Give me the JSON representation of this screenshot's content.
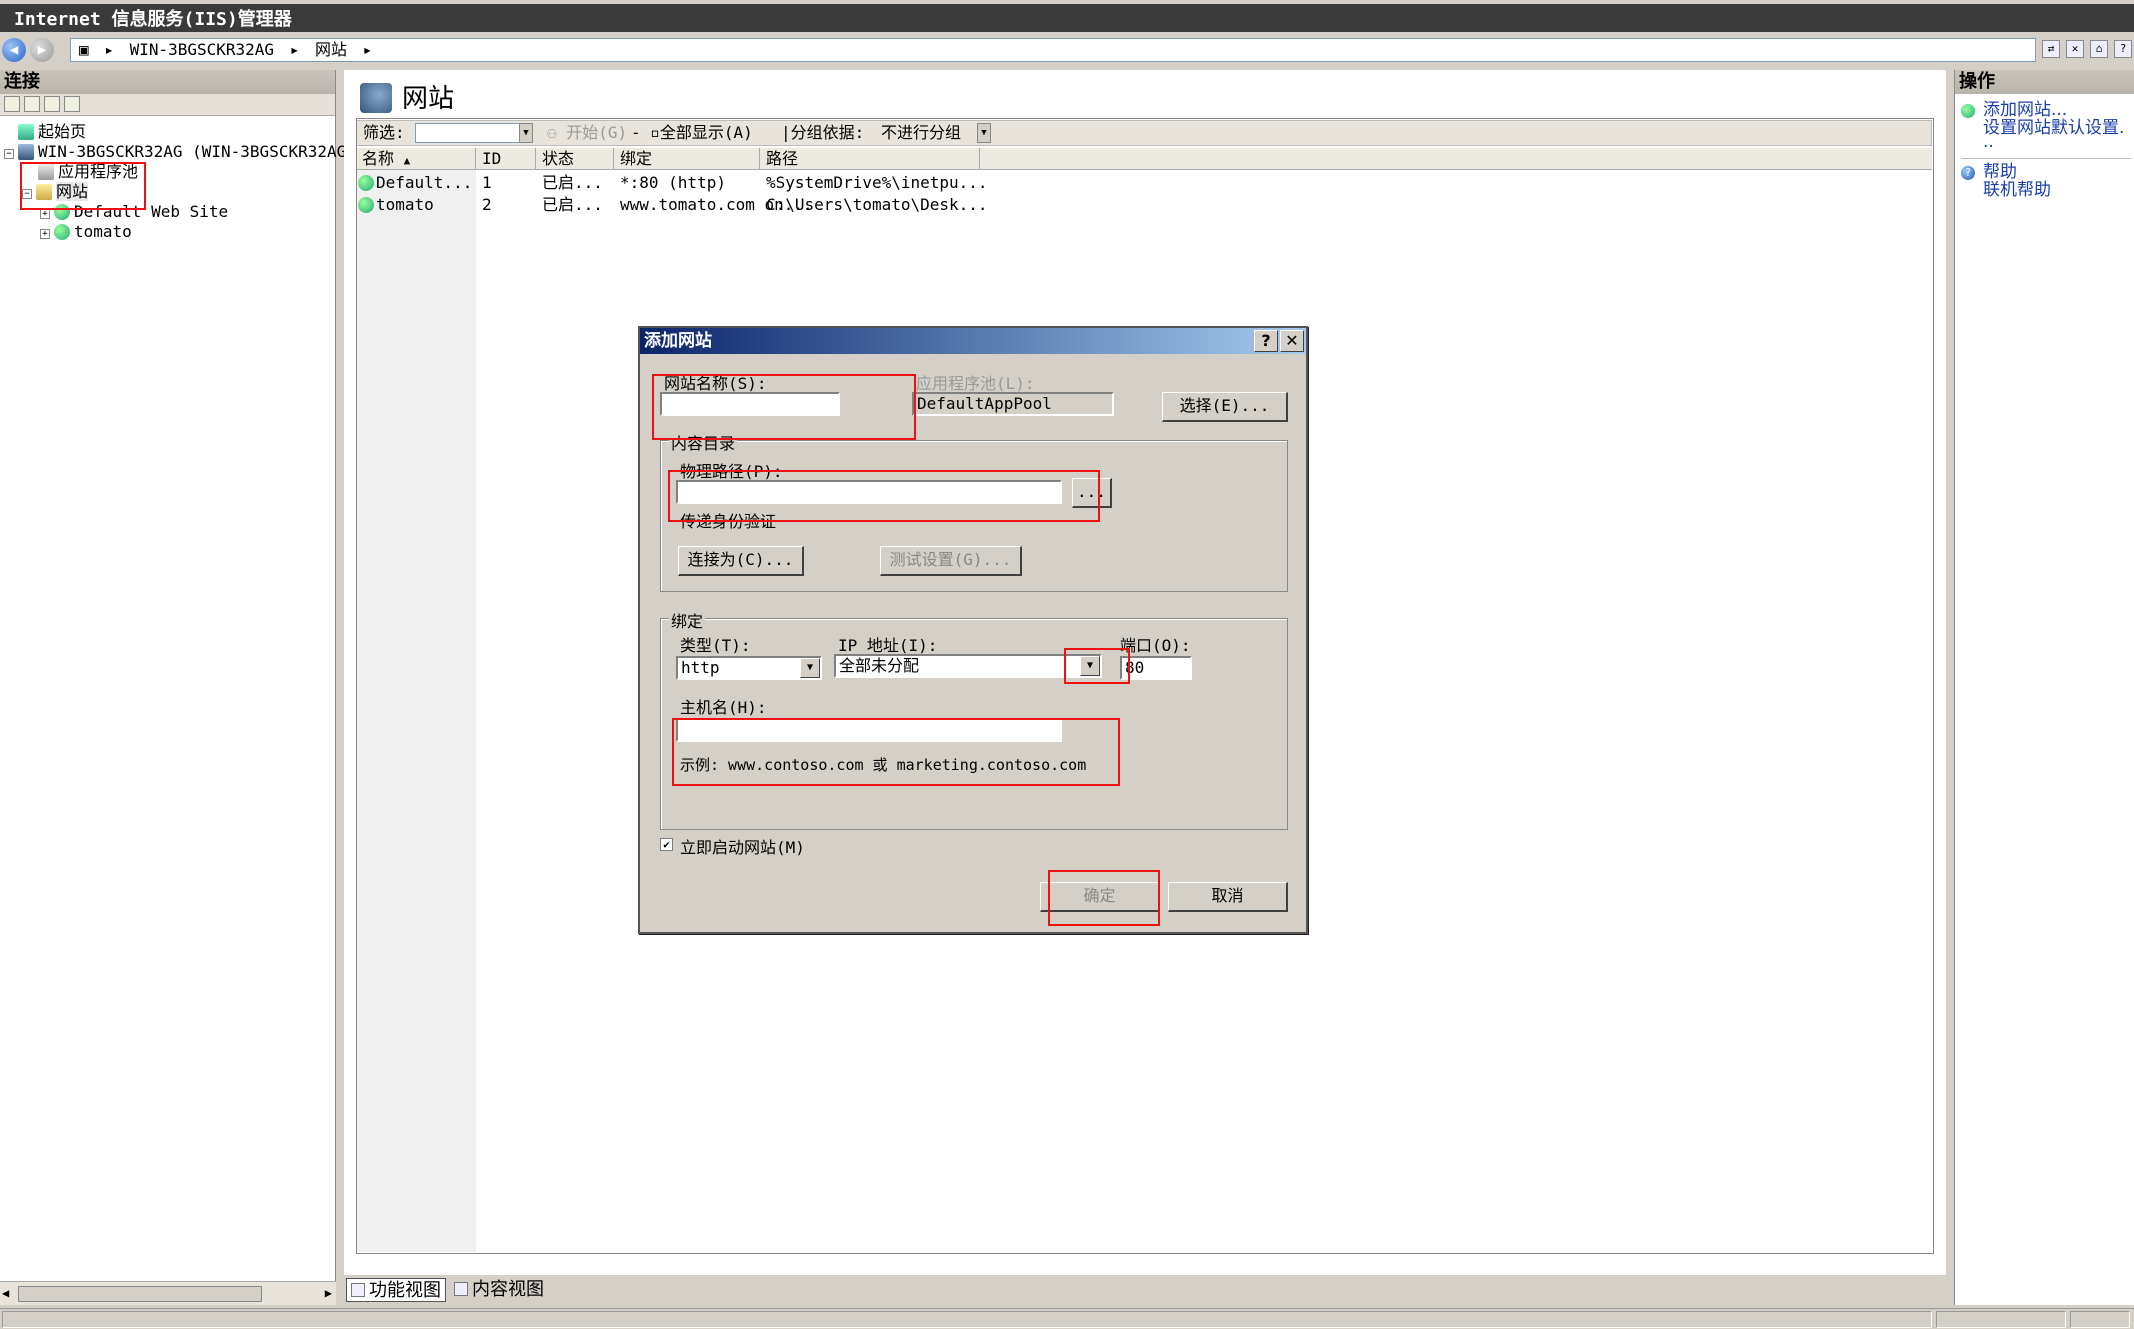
{
  "window": {
    "title": "Internet 信息服务(IIS)管理器"
  },
  "address": {
    "parts": [
      "WIN-3BGSCKR32AG",
      "网站"
    ],
    "separator": "▸"
  },
  "connections": {
    "header": "连接",
    "tree": {
      "start_page": "起始页",
      "server": "WIN-3BGSCKR32AG (WIN-3BGSCKR32AG\\",
      "app_pools": "应用程序池",
      "sites": "网站",
      "site1": "Default Web Site",
      "site2": "tomato"
    }
  },
  "center": {
    "title": "网站",
    "filter_label": "筛选:",
    "start_label": "开始(G)",
    "show_all_label": "全部显示(A)",
    "group_by_label": "分组依据:",
    "group_by_value": "不进行分组",
    "columns": [
      "名称",
      "ID",
      "状态",
      "绑定",
      "路径"
    ],
    "rows": [
      [
        "Default...",
        "1",
        "已启...",
        "*:80 (http)",
        "%SystemDrive%\\inetpu..."
      ],
      [
        "tomato",
        "2",
        "已启...",
        "www.tomato.com on...",
        "C:\\Users\\tomato\\Desk..."
      ]
    ],
    "tabs": {
      "features": "功能视图",
      "content": "内容视图"
    }
  },
  "actions": {
    "header": "操作",
    "add_site": "添加网站...",
    "defaults_line1": "设置网站默认设置.",
    "defaults_line2": "..",
    "help": "帮助",
    "online_help": "联机帮助"
  },
  "dialog": {
    "title": "添加网站",
    "help_btn": "?",
    "close_btn": "✕",
    "site_name_label": "网站名称(S):",
    "site_name_value": "",
    "app_pool_label": "应用程序池(L):",
    "app_pool_value": "DefaultAppPool",
    "select_btn": "选择(E)...",
    "content_dir_legend": "内容目录",
    "phys_path_label": "物理路径(P):",
    "phys_path_value": "",
    "browse_btn": "...",
    "passthrough_label": "传递身份验证",
    "connect_as_btn": "连接为(C)...",
    "test_settings_btn": "测试设置(G)...",
    "binding_legend": "绑定",
    "type_label": "类型(T):",
    "type_value": "http",
    "ip_label": "IP 地址(I):",
    "ip_value": "全部未分配",
    "port_label": "端口(O):",
    "port_value": "80",
    "host_label": "主机名(H):",
    "host_value": "",
    "example_text": "示例: www.contoso.com 或 marketing.contoso.com",
    "start_now_check": "✔",
    "start_now_label": "立即启动网站(M)",
    "ok_btn": "确定",
    "cancel_btn": "取消"
  },
  "colors": {
    "annotation": "#e11111",
    "link": "#1a3fa8",
    "dialog_title_start": "#0a246a"
  }
}
